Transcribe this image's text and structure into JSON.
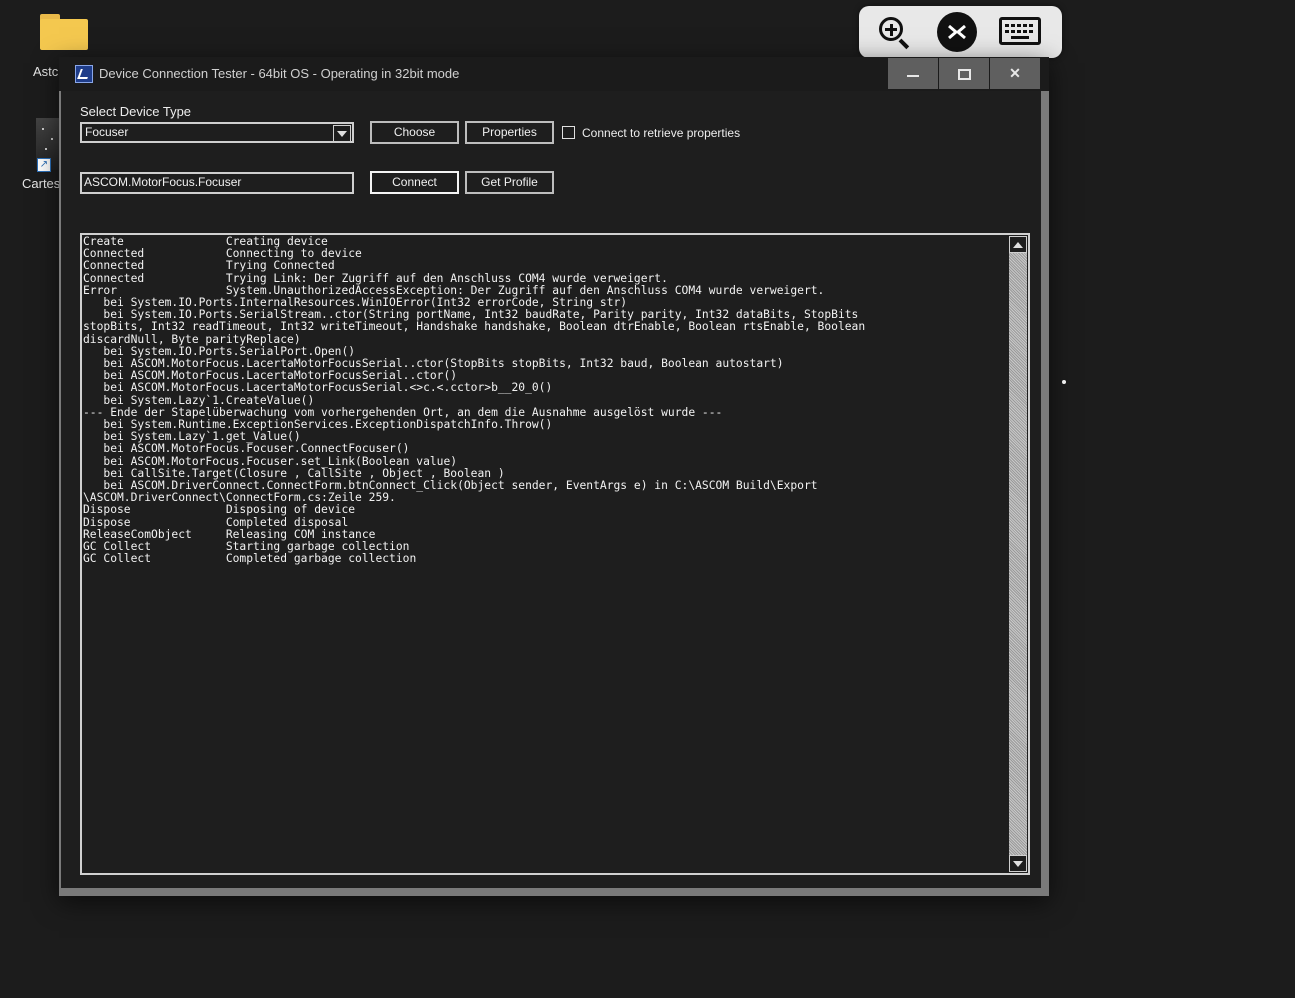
{
  "desktop": {
    "icons": [
      {
        "label": "Astc"
      },
      {
        "label": "Cartes"
      }
    ]
  },
  "window": {
    "title": "Device Connection Tester - 64bit OS - Operating in 32bit mode",
    "controls": {
      "minimize_icon": "minimize-icon",
      "maximize_icon": "maximize-icon",
      "close_glyph": "✕"
    }
  },
  "form": {
    "device_type_label": "Select Device Type",
    "device_type_value": "Focuser",
    "choose_label": "Choose",
    "properties_label": "Properties",
    "connect_props_checkbox_label": "Connect to retrieve properties",
    "connect_props_checked": false,
    "driver_id_value": "ASCOM.MotorFocus.Focuser",
    "connect_label": "Connect",
    "get_profile_label": "Get Profile"
  },
  "output": {
    "log": "Create               Creating device\nConnected            Connecting to device\nConnected            Trying Connected\nConnected            Trying Link: Der Zugriff auf den Anschluss COM4 wurde verweigert.\nError                System.UnauthorizedAccessException: Der Zugriff auf den Anschluss COM4 wurde verweigert.\n   bei System.IO.Ports.InternalResources.WinIOError(Int32 errorCode, String str)\n   bei System.IO.Ports.SerialStream..ctor(String portName, Int32 baudRate, Parity parity, Int32 dataBits, StopBits\nstopBits, Int32 readTimeout, Int32 writeTimeout, Handshake handshake, Boolean dtrEnable, Boolean rtsEnable, Boolean\ndiscardNull, Byte parityReplace)\n   bei System.IO.Ports.SerialPort.Open()\n   bei ASCOM.MotorFocus.LacertaMotorFocusSerial..ctor(StopBits stopBits, Int32 baud, Boolean autostart)\n   bei ASCOM.MotorFocus.LacertaMotorFocusSerial..ctor()\n   bei ASCOM.MotorFocus.LacertaMotorFocusSerial.<>c.<.cctor>b__20_0()\n   bei System.Lazy`1.CreateValue()\n--- Ende der Stapelüberwachung vom vorhergehenden Ort, an dem die Ausnahme ausgelöst wurde ---\n   bei System.Runtime.ExceptionServices.ExceptionDispatchInfo.Throw()\n   bei System.Lazy`1.get_Value()\n   bei ASCOM.MotorFocus.Focuser.ConnectFocuser()\n   bei ASCOM.MotorFocus.Focuser.set_Link(Boolean value)\n   bei CallSite.Target(Closure , CallSite , Object , Boolean )\n   bei ASCOM.DriverConnect.ConnectForm.btnConnect_Click(Object sender, EventArgs e) in C:\\ASCOM Build\\Export\n\\ASCOM.DriverConnect\\ConnectForm.cs:Zeile 259.\nDispose              Disposing of device\nDispose              Completed disposal\nReleaseComObject     Releasing COM instance\nGC Collect           Starting garbage collection\nGC Collect           Completed garbage collection"
  },
  "remote_toolbar": {
    "zoom_icon": "zoom-in-icon",
    "remote_icon": "remote-desktop-icon",
    "keyboard_icon": "keyboard-icon"
  }
}
